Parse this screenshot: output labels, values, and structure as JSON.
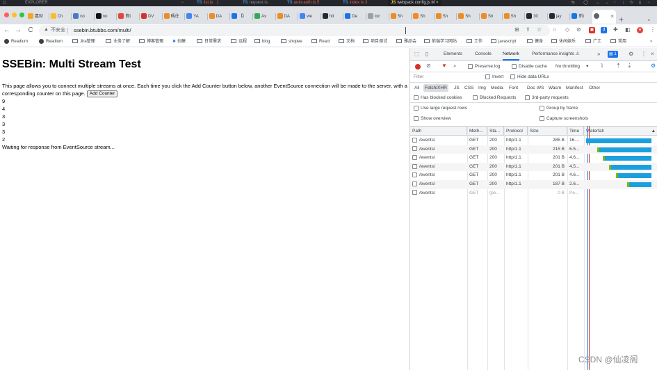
{
  "vscode": {
    "explorer_label": "EXPLORER",
    "tabs": [
      {
        "lang": "TS",
        "name": "list.ts",
        "status": "1"
      },
      {
        "lang": "TS",
        "name": "request.ts",
        "status": ""
      },
      {
        "lang": "TS",
        "name": "auto-auth.ts",
        "status": "5"
      },
      {
        "lang": "TS",
        "name": "index.ts",
        "status": "3"
      },
      {
        "lang": "JS",
        "name": "webpack.config.js",
        "status": "M"
      }
    ]
  },
  "browser": {
    "tabs": [
      {
        "label": "嘉财",
        "color": "#f6a623"
      },
      {
        "label": "Ch",
        "color": "#f9bd2c"
      },
      {
        "label": "no",
        "color": "#4a78c8"
      },
      {
        "label": "no",
        "color": "#111111"
      },
      {
        "label": "簡t",
        "color": "#e6453b"
      },
      {
        "label": "DV",
        "color": "#d93025"
      },
      {
        "label": "碼住",
        "color": "#f08a24"
      },
      {
        "label": "YA",
        "color": "#4285f4"
      },
      {
        "label": "DA",
        "color": "#f08a24"
      },
      {
        "label": "【t",
        "color": "#1a73e8"
      },
      {
        "label": "Ax",
        "color": "#34a853"
      },
      {
        "label": "DA",
        "color": "#f08a24"
      },
      {
        "label": "we",
        "color": "#4285f4"
      },
      {
        "label": "htt",
        "color": "#24292f"
      },
      {
        "label": "De",
        "color": "#1a73e8"
      },
      {
        "label": "loc",
        "color": "#9aa0a6"
      },
      {
        "label": "Sh",
        "color": "#f08a24"
      },
      {
        "label": "Sh",
        "color": "#f08a24"
      },
      {
        "label": "Sh",
        "color": "#f08a24"
      },
      {
        "label": "Sh",
        "color": "#f08a24"
      },
      {
        "label": "Sh",
        "color": "#f08a24"
      },
      {
        "label": "Sh",
        "color": "#f08a24"
      },
      {
        "label": "30",
        "color": "#24292f"
      },
      {
        "label": "jay",
        "color": "#24292f"
      },
      {
        "label": "新t",
        "color": "#1a73e8"
      }
    ],
    "active_tab_close": "×",
    "new_tab": "+",
    "insecure_label": "不安全",
    "url": "ssebin.btubbs.com/multi/"
  },
  "bookmarks": [
    {
      "label": "Readium",
      "icon": "globe"
    },
    {
      "label": "Readium",
      "icon": "globe"
    },
    {
      "label": "Jira管理",
      "icon": "folder"
    },
    {
      "label": "业务了解",
      "icon": "folder"
    },
    {
      "label": "博客管理",
      "icon": "folder"
    },
    {
      "label": "创建",
      "icon": "x-mark"
    },
    {
      "label": "日常需求",
      "icon": "folder"
    },
    {
      "label": "远程",
      "icon": "folder"
    },
    {
      "label": "blog",
      "icon": "folder"
    },
    {
      "label": "shopee",
      "icon": "folder"
    },
    {
      "label": "React",
      "icon": "folder"
    },
    {
      "label": "文档",
      "icon": "folder"
    },
    {
      "label": "项目调试",
      "icon": "folder"
    },
    {
      "label": "雅品会",
      "icon": "folder"
    },
    {
      "label": "前端学习网站",
      "icon": "folder"
    },
    {
      "label": "工作",
      "icon": "folder"
    },
    {
      "label": "javascript",
      "icon": "folder"
    },
    {
      "label": "健身",
      "icon": "folder"
    },
    {
      "label": "休闲娱乐",
      "icon": "folder"
    },
    {
      "label": "广工",
      "icon": "folder"
    },
    {
      "label": "常用",
      "icon": "folder"
    }
  ],
  "page": {
    "title": "SSEBin: Multi Stream Test",
    "description": "This page allows you to connect multiple streams at once. Each time you click the Add Counter button below, another EventSource connection will be made to the server, with a corresponding counter on this page.",
    "add_button": "Add Counter",
    "counters": [
      "9",
      "4",
      "3",
      "3",
      "3",
      "2"
    ],
    "waiting": "Waiting for response from EventSource stream..."
  },
  "devtools": {
    "tabs": [
      "Elements",
      "Console",
      "Network",
      "Performance insights"
    ],
    "active_tab": "Network",
    "issues_count": "1",
    "preserve_log": "Preserve log",
    "disable_cache": "Disable cache",
    "throttling": "No throttling",
    "filter_placeholder": "Filter",
    "invert": "Invert",
    "hide_data_urls": "Hide data URLs",
    "types": [
      "All",
      "Fetch/XHR",
      "JS",
      "CSS",
      "Img",
      "Media",
      "Font",
      "Doc",
      "WS",
      "Wasm",
      "Manifest",
      "Other"
    ],
    "active_type": "Fetch/XHR",
    "blocked_cookies": "Has blocked cookies",
    "blocked_requests": "Blocked Requests",
    "third_party": "3rd-party requests",
    "large_rows": "Use large request rows",
    "group_by_frame": "Group by frame",
    "show_overview": "Show overview",
    "capture_screenshots": "Capture screenshots",
    "columns": [
      "Path",
      "Meth...",
      "Sta...",
      "Protocol",
      "Size",
      "Time",
      "Waterfall"
    ],
    "rows": [
      {
        "path": "/events/",
        "method": "GET",
        "status": "200",
        "protocol": "http/1.1",
        "size": "285 B",
        "time": "16...."
      },
      {
        "path": "/events/",
        "method": "GET",
        "status": "200",
        "protocol": "http/1.1",
        "size": "215 B",
        "time": "6.5..."
      },
      {
        "path": "/events/",
        "method": "GET",
        "status": "200",
        "protocol": "http/1.1",
        "size": "201 B",
        "time": "4.6..."
      },
      {
        "path": "/events/",
        "method": "GET",
        "status": "200",
        "protocol": "http/1.1",
        "size": "201 B",
        "time": "4.5..."
      },
      {
        "path": "/events/",
        "method": "GET",
        "status": "200",
        "protocol": "http/1.1",
        "size": "201 B",
        "time": "4.6..."
      },
      {
        "path": "/events/",
        "method": "GET",
        "status": "200",
        "protocol": "http/1.1",
        "size": "187 B",
        "time": "2.6..."
      },
      {
        "path": "/events/",
        "method": "GET",
        "status": "(pe...",
        "protocol": "",
        "size": "0 B",
        "time": "Pe..."
      }
    ],
    "waterfall_progress": [
      1.0,
      0.8,
      0.72,
      0.62,
      0.52,
      0.35
    ]
  },
  "watermark": "CSDN @仙凌阁",
  "colors": {
    "accent": "#1a73e8",
    "record": "#d93025",
    "waterfall": "#1ba0dd"
  }
}
